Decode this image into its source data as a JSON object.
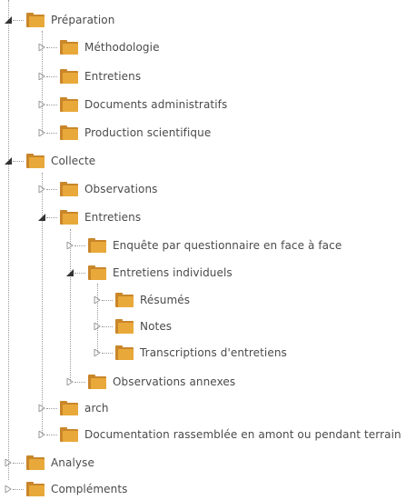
{
  "tree": {
    "preparation": {
      "label": "Préparation",
      "state": "expanded",
      "children": [
        {
          "label": "Méthodologie",
          "state": "collapsed"
        },
        {
          "label": "Entretiens",
          "state": "collapsed"
        },
        {
          "label": "Documents administratifs",
          "state": "collapsed"
        },
        {
          "label": "Production scientifique",
          "state": "collapsed"
        }
      ]
    },
    "collecte": {
      "label": "Collecte",
      "state": "expanded",
      "observations": {
        "label": "Observations",
        "state": "collapsed"
      },
      "entretiens": {
        "label": "Entretiens",
        "state": "expanded",
        "enquete": {
          "label": "Enquête par questionnaire en face à face",
          "state": "collapsed"
        },
        "individuels": {
          "label": "Entretiens individuels",
          "state": "expanded",
          "children": [
            {
              "label": "Résumés",
              "state": "collapsed"
            },
            {
              "label": "Notes",
              "state": "collapsed"
            },
            {
              "label": "Transcriptions d'entretiens",
              "state": "collapsed"
            }
          ]
        },
        "annexes": {
          "label": "Observations annexes",
          "state": "collapsed"
        }
      },
      "arch": {
        "label": "arch",
        "state": "collapsed"
      },
      "documentation": {
        "label": "Documentation rassemblée en amont ou pendant terrain",
        "state": "collapsed"
      }
    },
    "analyse": {
      "label": "Analyse",
      "state": "collapsed"
    },
    "complements": {
      "label": "Compléments",
      "state": "collapsed"
    }
  },
  "colors": {
    "text": "#4a4a4a",
    "folder": "#e8a93a",
    "folder_dark": "#c9862a",
    "lines": "#9a9a9a"
  },
  "icons": {
    "folder": "folder-icon",
    "expanded": "triangle-down-icon",
    "collapsed": "triangle-right-icon"
  }
}
